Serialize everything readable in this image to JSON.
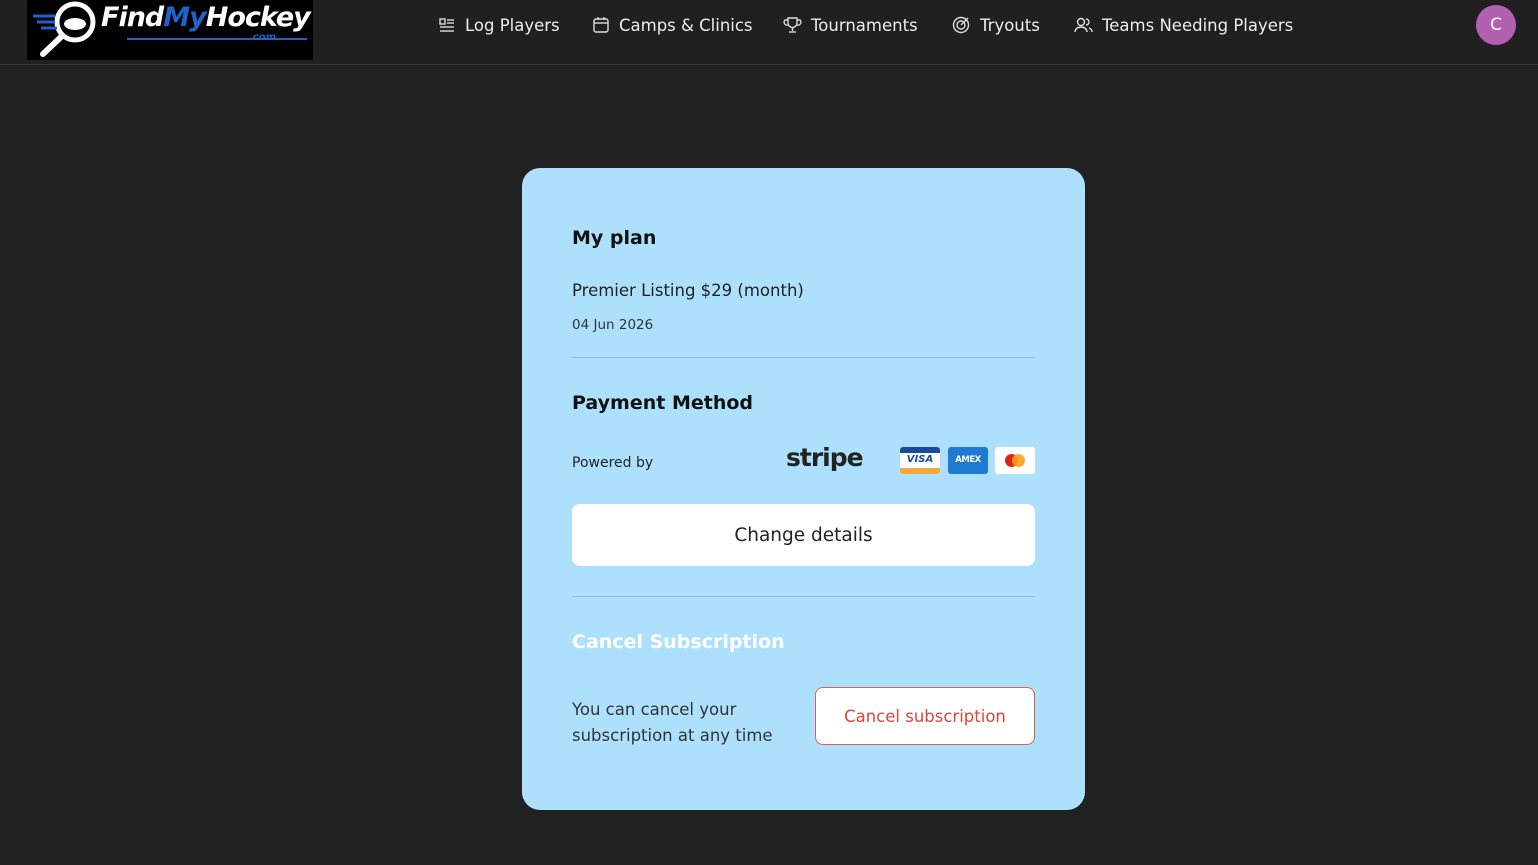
{
  "header": {
    "logo_text_find": "Find",
    "logo_text_my": "My",
    "logo_text_hockey": "Hockey",
    "logo_sub": ".com",
    "nav": [
      {
        "label": "Log Players",
        "icon": "list-icon"
      },
      {
        "label": "Camps & Clinics",
        "icon": "calendar-icon"
      },
      {
        "label": "Tournaments",
        "icon": "trophy-icon"
      },
      {
        "label": "Tryouts",
        "icon": "target-icon"
      },
      {
        "label": "Teams Needing Players",
        "icon": "users-icon"
      }
    ],
    "avatar_initial": "C"
  },
  "plan": {
    "title": "My plan",
    "name": "Premier Listing $29 (month)",
    "date": "04 Jun 2026"
  },
  "payment": {
    "title": "Payment Method",
    "powered_by": "Powered by",
    "provider": "stripe",
    "cards": [
      "VISA",
      "AMEX",
      "mastercard"
    ],
    "change_button": "Change details"
  },
  "cancel": {
    "title": "Cancel Subscription",
    "description": "You can cancel your subscription at any time",
    "button": "Cancel subscription"
  },
  "colors": {
    "background": "#212121",
    "card": "#ade0fc",
    "avatar": "#b261b0",
    "danger": "#d9473b",
    "brand_blue": "#1d63c9"
  }
}
